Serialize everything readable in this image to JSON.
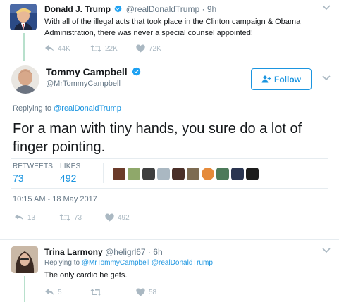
{
  "tweet1": {
    "name": "Donald J. Trump",
    "handle": "@realDonaldTrump",
    "time": "9h",
    "text": "With all of the illegal acts that took place in the Clinton campaign & Obama Administration, there was never a special counsel appointed!",
    "retweets": "22K",
    "replies": "44K",
    "likes": "72K"
  },
  "tweet2": {
    "name": "Tommy Campbell",
    "handle": "@MrTommyCampbell",
    "follow_label": "Follow",
    "replying_prefix": "Replying to",
    "replying_to": "@realDonaldTrump",
    "text": "For a man with tiny hands, you sure do a lot of finger pointing.",
    "retweets_label": "RETWEETS",
    "retweets_value": "73",
    "likes_label": "LIKES",
    "likes_value": "492",
    "timestamp": "10:15 AM - 18 May 2017",
    "action_replies": "13",
    "action_retweets": "73",
    "action_likes": "492"
  },
  "tweet3": {
    "name": "Trina Larmony",
    "handle": "@heligrl67",
    "time": "6h",
    "replying_prefix": "Replying to",
    "replying_to": "@MrTommyCampbell @realDonaldTrump",
    "text": "The only cardio he gets.",
    "replies": "5",
    "likes": "58"
  },
  "colors": {
    "link": "#1b95e0",
    "muted": "#657786",
    "action": "#aab8c2",
    "thread": "#b8e0cc",
    "verified": "#1da1f2"
  },
  "icons": [
    "verified-icon",
    "chevron-down-icon",
    "reply-icon",
    "retweet-icon",
    "heart-icon",
    "follow-person-icon",
    "separator-dot"
  ],
  "liker_avatars": [
    "liker-1",
    "liker-2",
    "liker-3",
    "liker-4",
    "liker-5",
    "liker-6",
    "liker-7",
    "liker-8",
    "liker-9",
    "liker-10"
  ]
}
